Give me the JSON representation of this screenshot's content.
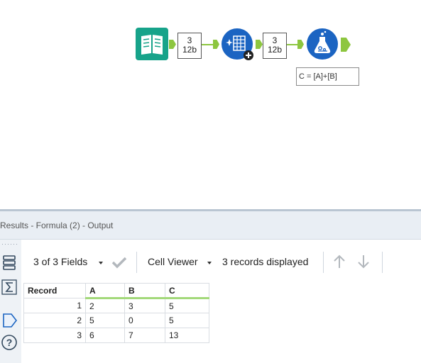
{
  "workflow": {
    "tools": [
      {
        "name": "input-data-tool",
        "icon": "book-icon",
        "color": "#17a38a"
      },
      {
        "name": "sample-tool",
        "icon": "grid-sparkle-icon",
        "color": "#1b64c2"
      },
      {
        "name": "formula-tool",
        "icon": "flask-icon",
        "color": "#1b64c2"
      }
    ],
    "connections": [
      {
        "records": "3",
        "size": "12b"
      },
      {
        "records": "3",
        "size": "12b"
      }
    ],
    "formula_annotation": "C = [A]+[B]",
    "connection_color": "#8dc63f"
  },
  "results": {
    "title": "Results - Formula (2) - Output",
    "fields_label": "3 of 3 Fields",
    "cell_viewer_label": "Cell Viewer",
    "records_displayed": "3 records displayed",
    "columns": [
      "Record",
      "A",
      "B",
      "C"
    ],
    "rows": [
      [
        "1",
        "2",
        "3",
        "5"
      ],
      [
        "2",
        "5",
        "0",
        "5"
      ],
      [
        "3",
        "6",
        "7",
        "13"
      ]
    ]
  }
}
